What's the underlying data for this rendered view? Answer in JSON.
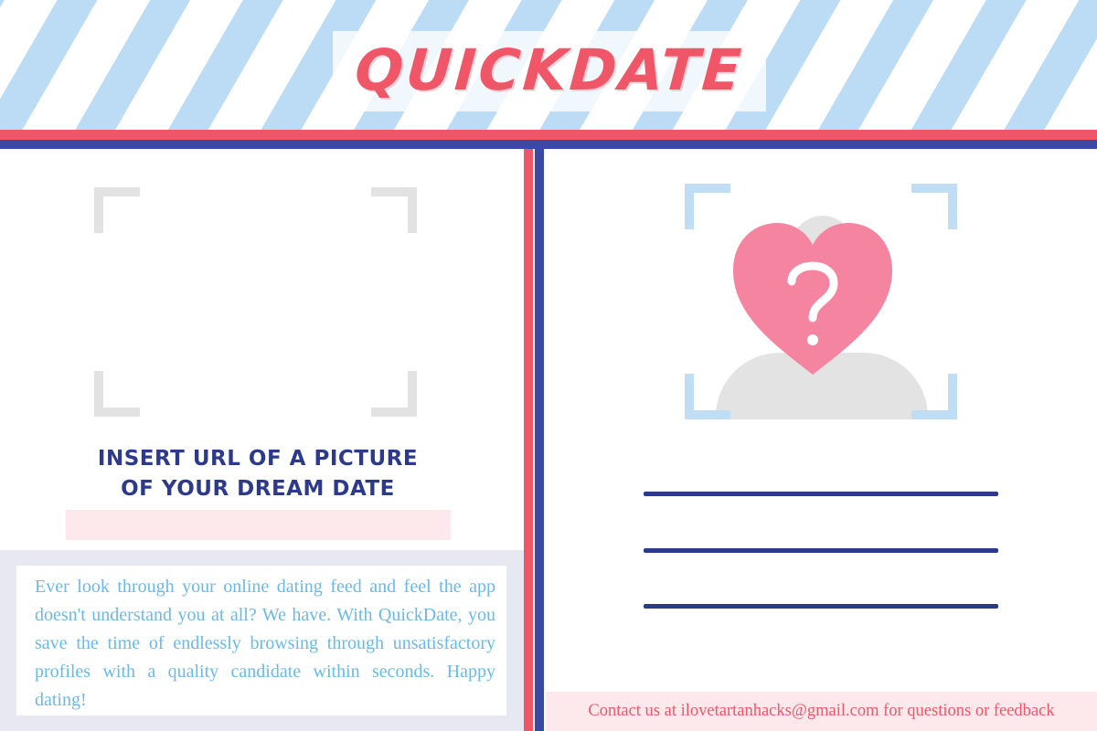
{
  "header": {
    "title": "QUICKDATE"
  },
  "upload": {
    "prompt_line1": "INSERT URL OF A PICTURE",
    "prompt_line2": "OF YOUR DREAM DATE",
    "url_placeholder": "",
    "url_value": ""
  },
  "about": {
    "text": "Ever look through your online dating feed and feel the app doesn't understand you at all?  We have. With QuickDate,  you save the time of endlessly browsing through unsatisfactory profiles with a quality candidate within seconds.  Happy dating!"
  },
  "profile": {
    "placeholder_icon": "heart-question-icon",
    "heart_glyph": "?"
  },
  "footer": {
    "contact": "Contact us at ilovetartanhacks@gmail.com for questions or feedback"
  },
  "colors": {
    "accent_red": "#ef5768",
    "accent_blue": "#3a48a6",
    "stripe_light_blue": "#bcdcf5",
    "heart_pink": "#f4849f",
    "text_navy": "#2d3a8c",
    "about_text_blue": "#6ab9e6"
  }
}
